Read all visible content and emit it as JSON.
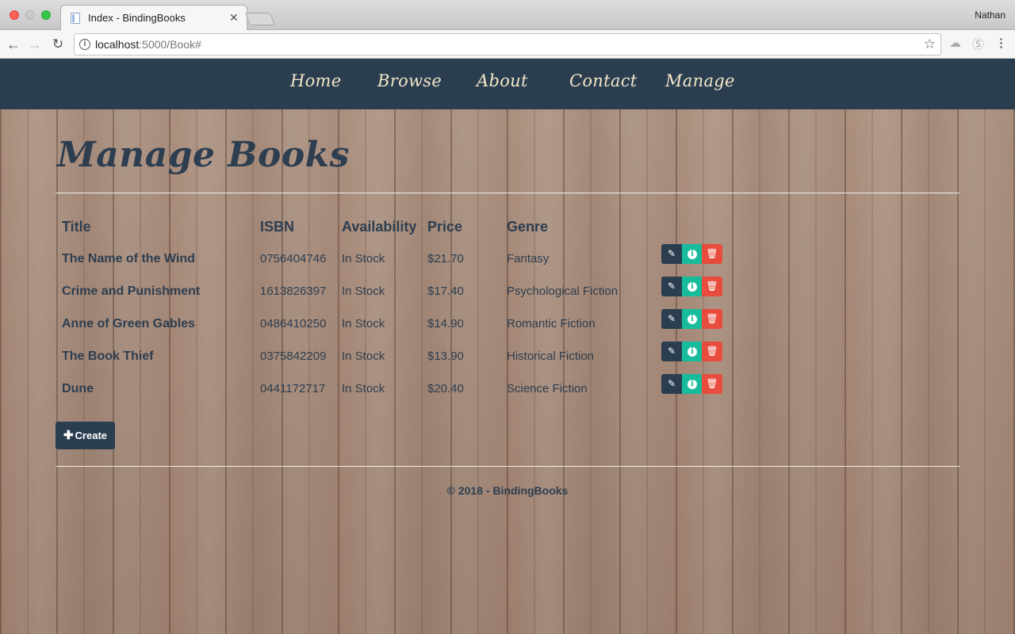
{
  "browser": {
    "tab_title": "Index - BindingBooks",
    "profile_name": "Nathan",
    "url_host": "localhost",
    "url_rest": ":5000/Book#"
  },
  "nav": {
    "items": [
      "Home",
      "Browse",
      "About",
      "Contact",
      "Manage"
    ]
  },
  "page": {
    "title": "Manage Books",
    "columns": {
      "title": "Title",
      "isbn": "ISBN",
      "availability": "Availability",
      "price": "Price",
      "genre": "Genre"
    },
    "books": [
      {
        "title": "The Name of the Wind",
        "isbn": "0756404746",
        "availability": "In Stock",
        "price": "$21.70",
        "genre": "Fantasy"
      },
      {
        "title": "Crime and Punishment",
        "isbn": "1613826397",
        "availability": "In Stock",
        "price": "$17.40",
        "genre": "Psychological Fiction"
      },
      {
        "title": "Anne of Green Gables",
        "isbn": "0486410250",
        "availability": "In Stock",
        "price": "$14.90",
        "genre": "Romantic Fiction"
      },
      {
        "title": "The Book Thief",
        "isbn": "0375842209",
        "availability": "In Stock",
        "price": "$13.90",
        "genre": "Historical Fiction"
      },
      {
        "title": "Dune",
        "isbn": "0441172717",
        "availability": "In Stock",
        "price": "$20.40",
        "genre": "Science Fiction"
      }
    ],
    "create_label": "Create",
    "footer": "© 2018 - BindingBooks"
  },
  "colors": {
    "navbar": "#2b3e50",
    "edit": "#2b3e50",
    "info": "#18bc9c",
    "delete": "#e74c3c"
  },
  "icons": {
    "edit": "pencil-icon",
    "details": "info-circle-icon",
    "delete": "trash-icon",
    "create": "plus-icon"
  }
}
